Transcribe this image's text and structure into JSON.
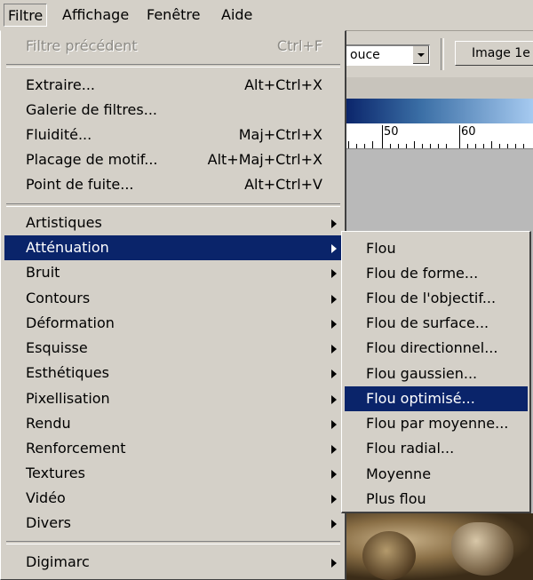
{
  "menubar": {
    "items": [
      "Filtre",
      "Affichage",
      "Fenêtre",
      "Aide"
    ]
  },
  "options_bar": {
    "combo_value": "ouce",
    "image_button": "Image 1e"
  },
  "ruler": {
    "labels": [
      "50",
      "60"
    ]
  },
  "filter_menu": {
    "previous": {
      "label": "Filtre précédent",
      "shortcut": "Ctrl+F"
    },
    "extract": {
      "label": "Extraire...",
      "shortcut": "Alt+Ctrl+X"
    },
    "gallery": {
      "label": "Galerie de filtres..."
    },
    "liquify": {
      "label": "Fluidité...",
      "shortcut": "Maj+Ctrl+X"
    },
    "pattern": {
      "label": "Placage de motif...",
      "shortcut": "Alt+Maj+Ctrl+X"
    },
    "vanishing": {
      "label": "Point de fuite...",
      "shortcut": "Alt+Ctrl+V"
    },
    "categories": [
      "Artistiques",
      "Atténuation",
      "Bruit",
      "Contours",
      "Déformation",
      "Esquisse",
      "Esthétiques",
      "Pixellisation",
      "Rendu",
      "Renforcement",
      "Textures",
      "Vidéo",
      "Divers"
    ],
    "digimarc": "Digimarc"
  },
  "blur_submenu": {
    "items": [
      "Flou",
      "Flou de forme...",
      "Flou de l'objectif...",
      "Flou de surface...",
      "Flou directionnel...",
      "Flou gaussien...",
      "Flou optimisé...",
      "Flou par moyenne...",
      "Flou radial...",
      "Moyenne",
      "Plus flou"
    ]
  },
  "colors": {
    "highlight": "#0a246a",
    "menu_bg": "#d4d0c8",
    "disabled_text": "#8c8a84"
  }
}
